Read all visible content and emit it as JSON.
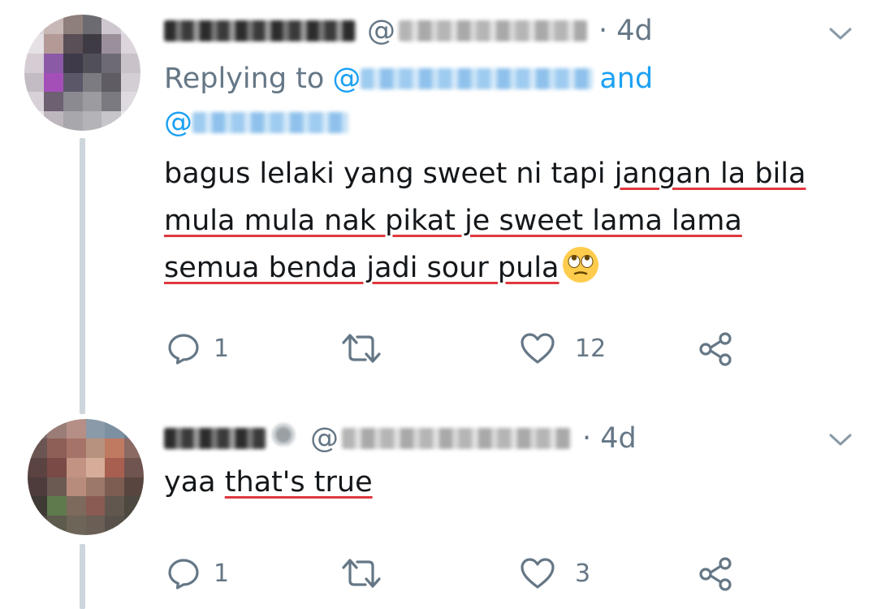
{
  "tweets": [
    {
      "display_name_obscured": true,
      "handle_prefix": "@",
      "time": "· 4d",
      "replying_to_label": "Replying to",
      "mention_prefix": "@",
      "and_label": "and",
      "body_lines": [
        {
          "plain": "bagus lelaki yang sweet ni tapi ",
          "underlined": "jangan la bila"
        },
        {
          "plain": "",
          "underlined": "mula mula nak pikat je sweet lama lama"
        },
        {
          "plain": "",
          "underlined": "semua benda jadi sour pula"
        }
      ],
      "emoji": "face-with-rolling-eyes",
      "reply_count": "1",
      "like_count": "12",
      "icons": [
        "reply-icon",
        "retweet-icon",
        "like-icon",
        "share-icon",
        "chevron-down-icon"
      ]
    },
    {
      "display_name_obscured": true,
      "handle_prefix": "@",
      "time": "· 4d",
      "body_lines": [
        {
          "plain": "yaa ",
          "underlined": "that's true"
        }
      ],
      "reply_count": "1",
      "like_count": "3",
      "icons": [
        "reply-icon",
        "retweet-icon",
        "like-icon",
        "share-icon",
        "chevron-down-icon"
      ]
    }
  ],
  "colors": {
    "secondary_text": "#657786",
    "link": "#1da1f2",
    "thread_line": "#cdd6dd",
    "spellcheck_underline": "#e0383e"
  }
}
